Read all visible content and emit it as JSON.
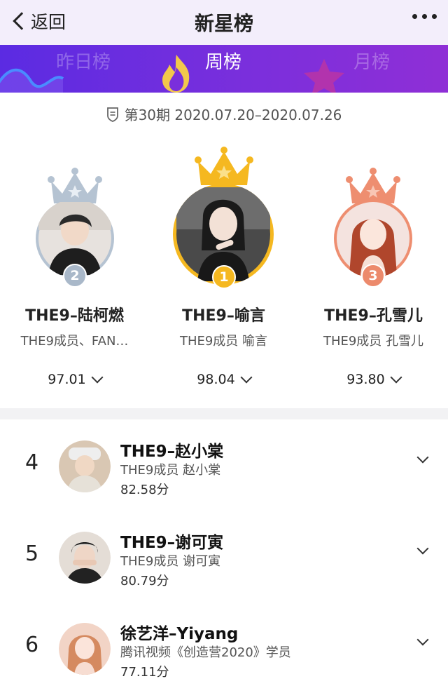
{
  "header": {
    "back_label": "返回",
    "title": "新星榜"
  },
  "tabs": [
    {
      "label": "昨日榜",
      "active": false
    },
    {
      "label": "周榜",
      "active": true
    },
    {
      "label": "月榜",
      "active": false
    }
  ],
  "period": {
    "label": "第30期 2020.07.20–2020.07.26"
  },
  "podium": [
    {
      "rank": "2",
      "name": "THE9–陆柯燃",
      "desc": "THE9成员、FAN…",
      "score": "97.01",
      "color": "#a9b8c9"
    },
    {
      "rank": "1",
      "name": "THE9–喻言",
      "desc": "THE9成员 喻言",
      "score": "98.04",
      "color": "#f5b820"
    },
    {
      "rank": "3",
      "name": "THE9–孔雪儿",
      "desc": "THE9成员 孔雪儿",
      "score": "93.80",
      "color": "#ec8a6c"
    }
  ],
  "list": [
    {
      "rank": "4",
      "name": "THE9–赵小棠",
      "desc": "THE9成员 赵小棠",
      "score": "82.58分"
    },
    {
      "rank": "5",
      "name": "THE9–谢可寅",
      "desc": "THE9成员 谢可寅",
      "score": "80.79分"
    },
    {
      "rank": "6",
      "name": "徐艺洋–Yiyang",
      "desc": "腾讯视频《创造营2020》学员",
      "score": "77.11分"
    }
  ],
  "colors": {
    "accent": "#6a2de0",
    "gold": "#f5b820",
    "silver": "#a9b8c9",
    "bronze": "#ec8a6c"
  }
}
